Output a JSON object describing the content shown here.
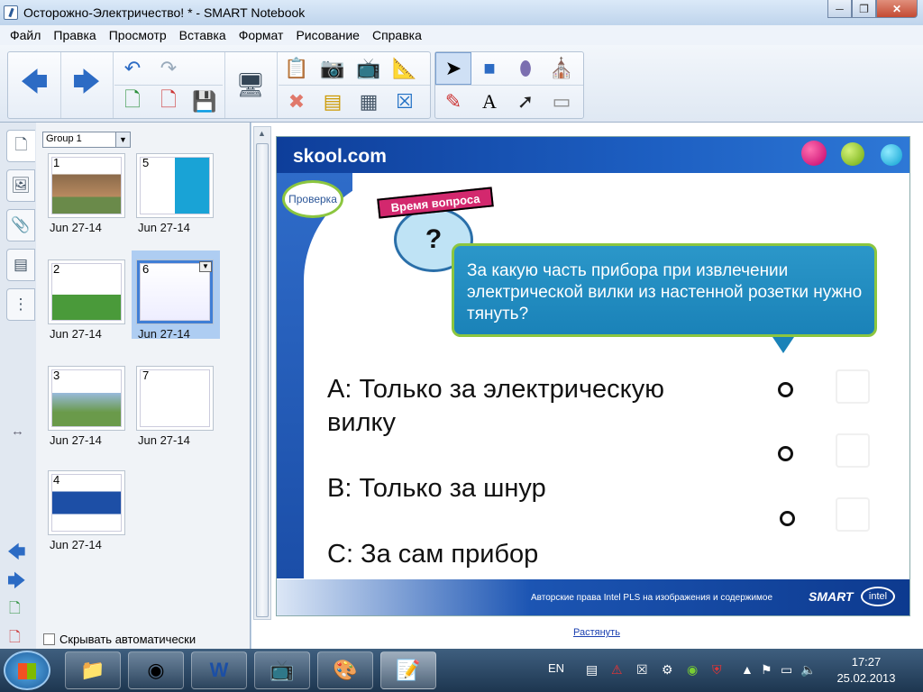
{
  "window": {
    "title": "Осторожно-Электричество! * - SMART Notebook"
  },
  "menu": [
    "Файл",
    "Правка",
    "Просмотр",
    "Вставка",
    "Формат",
    "Рисование",
    "Справка"
  ],
  "sidebar": {
    "group_label": "Group 1",
    "thumbnails": [
      {
        "num": "1",
        "label": "Jun 27-14"
      },
      {
        "num": "5",
        "label": "Jun 27-14"
      },
      {
        "num": "2",
        "label": "Jun 27-14"
      },
      {
        "num": "6",
        "label": "Jun 27-14"
      },
      {
        "num": "3",
        "label": "Jun 27-14"
      },
      {
        "num": "7",
        "label": "Jun 27-14"
      },
      {
        "num": "4",
        "label": "Jun 27-14"
      }
    ],
    "autohide_label": "Скрывать автоматически"
  },
  "slide": {
    "logo": "skool.com",
    "check_button": "Проверка",
    "badge": "Время вопроса",
    "question": "За какую часть прибора при извлечении электрической вилки из настенной розетки нужно тянуть?",
    "answers": [
      {
        "line1": "A: Только за электрическую",
        "line2": "вилку"
      },
      {
        "line1": "B: Только за шнур",
        "line2": ""
      },
      {
        "line1": "C: За сам прибор",
        "line2": ""
      }
    ],
    "copyright": "Авторские права Intel PLS на изображения и содержимое",
    "smart_logo": "SMART",
    "intel_logo": "intel"
  },
  "stretch_link": "Растянуть",
  "taskbar": {
    "lang": "EN",
    "time": "17:27",
    "date": "25.02.2013"
  }
}
